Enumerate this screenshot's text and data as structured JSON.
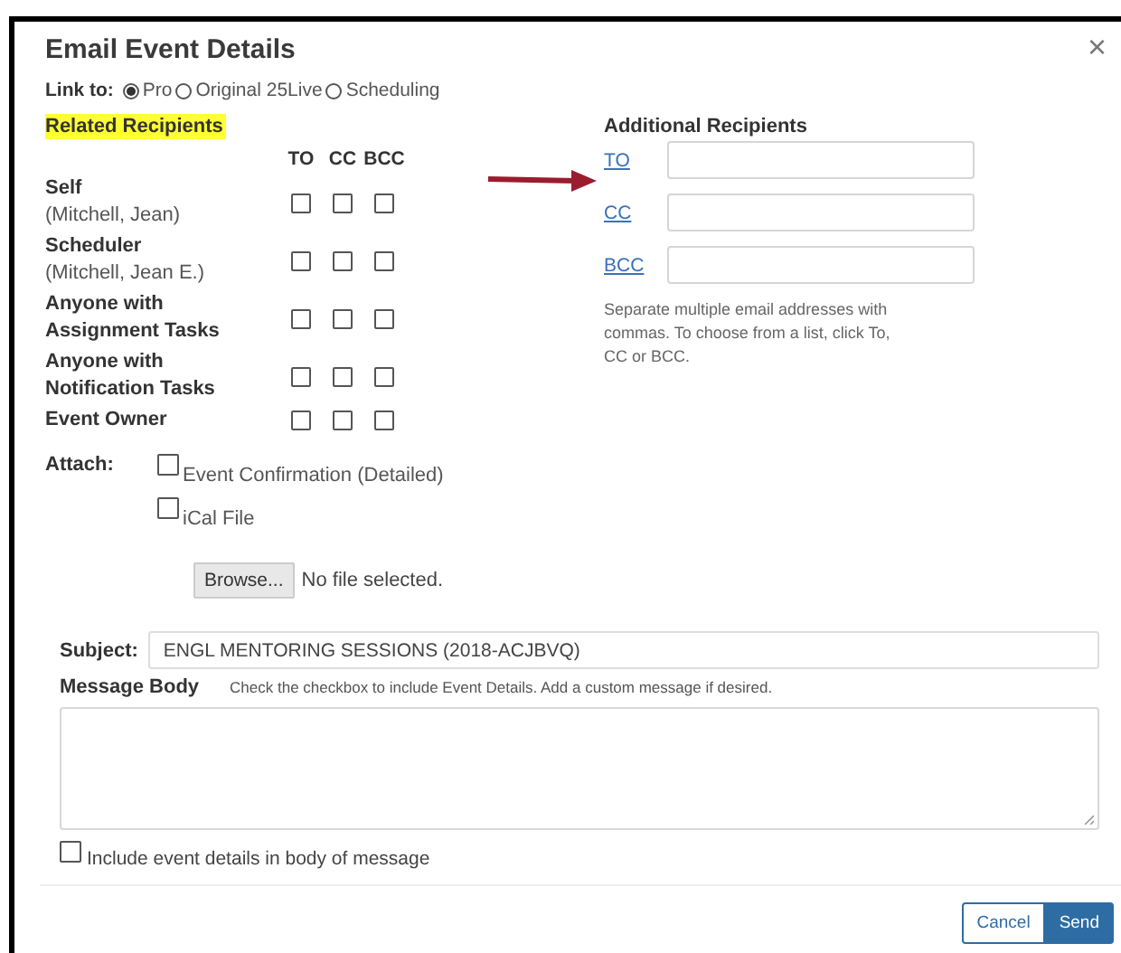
{
  "dialog": {
    "title": "Email Event Details",
    "close": "×"
  },
  "link_to": {
    "label": "Link to:",
    "options": [
      {
        "label": "Pro",
        "selected": true
      },
      {
        "label": "Original 25Live",
        "selected": false
      },
      {
        "label": "Scheduling",
        "selected": false
      }
    ]
  },
  "related_recipients": {
    "heading": "Related Recipients",
    "highlighted": true,
    "columns": [
      "TO",
      "CC",
      "BCC"
    ],
    "rows": [
      {
        "name": "Self",
        "detail": "(Mitchell, Jean)",
        "to": false,
        "cc": false,
        "bcc": false
      },
      {
        "name": "Scheduler",
        "detail": "(Mitchell, Jean E.)",
        "to": false,
        "cc": false,
        "bcc": false
      },
      {
        "name": "Anyone with Assignment Tasks",
        "to": false,
        "cc": false,
        "bcc": false
      },
      {
        "name": "Anyone with Notification Tasks",
        "to": false,
        "cc": false,
        "bcc": false
      },
      {
        "name": "Event Owner",
        "to": false,
        "cc": false,
        "bcc": false
      }
    ]
  },
  "additional_recipients": {
    "heading": "Additional Recipients",
    "fields": [
      {
        "label": "TO"
      },
      {
        "label": "CC"
      },
      {
        "label": "BCC"
      }
    ],
    "help": "Separate multiple email addresses with commas. To choose from a list, click To, CC or BCC."
  },
  "attach": {
    "label": "Attach:",
    "options": [
      {
        "label": "Event Confirmation (Detailed)",
        "checked": false
      },
      {
        "label": "iCal File",
        "checked": false
      }
    ],
    "browse_button": "Browse...",
    "file_status": "No file selected."
  },
  "subject": {
    "label": "Subject:",
    "value": "ENGL MENTORING SESSIONS (2018-ACJBVQ)"
  },
  "message_body": {
    "label": "Message Body",
    "hint": "Check the checkbox to include Event Details. Add a custom message if desired.",
    "include": {
      "label": "Include event details in body of message",
      "checked": false
    }
  },
  "buttons": [
    {
      "label": "Cancel",
      "kind": "secondary"
    },
    {
      "label": "Send",
      "kind": "primary"
    }
  ]
}
